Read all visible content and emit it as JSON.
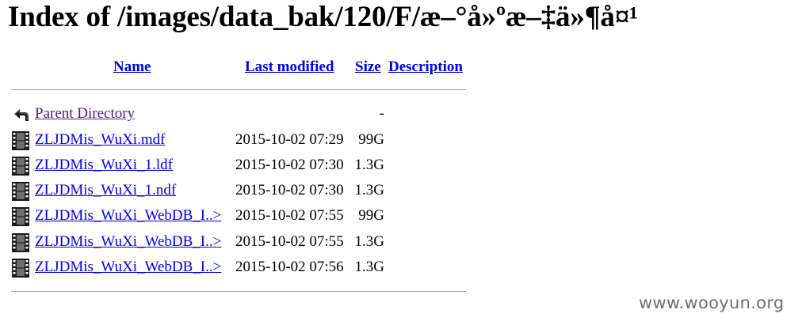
{
  "title": "Index of /images/data_bak/120/F/æ–°å»ºæ–‡ä»¶å¤¹",
  "table": {
    "headers": {
      "name": "Name",
      "last_modified": "Last modified",
      "size": "Size",
      "description": "Description"
    },
    "parent": {
      "name": "Parent Directory",
      "date": "",
      "size": "-",
      "icon": "back-arrow-icon"
    },
    "rows": [
      {
        "name": "ZLJDMis_WuXi.mdf",
        "date": "2015-10-02 07:29",
        "size": "99G",
        "icon": "film-strip-icon"
      },
      {
        "name": "ZLJDMis_WuXi_1.ldf",
        "date": "2015-10-02 07:30",
        "size": "1.3G",
        "icon": "film-strip-icon"
      },
      {
        "name": "ZLJDMis_WuXi_1.ndf",
        "date": "2015-10-02 07:30",
        "size": "1.3G",
        "icon": "film-strip-icon"
      },
      {
        "name": "ZLJDMis_WuXi_WebDB_I..>",
        "date": "2015-10-02 07:55",
        "size": "99G",
        "icon": "film-strip-icon"
      },
      {
        "name": "ZLJDMis_WuXi_WebDB_I..>",
        "date": "2015-10-02 07:55",
        "size": "1.3G",
        "icon": "film-strip-icon"
      },
      {
        "name": "ZLJDMis_WuXi_WebDB_I..>",
        "date": "2015-10-02 07:56",
        "size": "1.3G",
        "icon": "film-strip-icon"
      }
    ]
  },
  "watermark": "www.wooyun.org",
  "colors": {
    "link": "#0000ee",
    "visited_link": "#551a8b",
    "rule": "#9a9a9a",
    "watermark": "#6f6f6f"
  }
}
